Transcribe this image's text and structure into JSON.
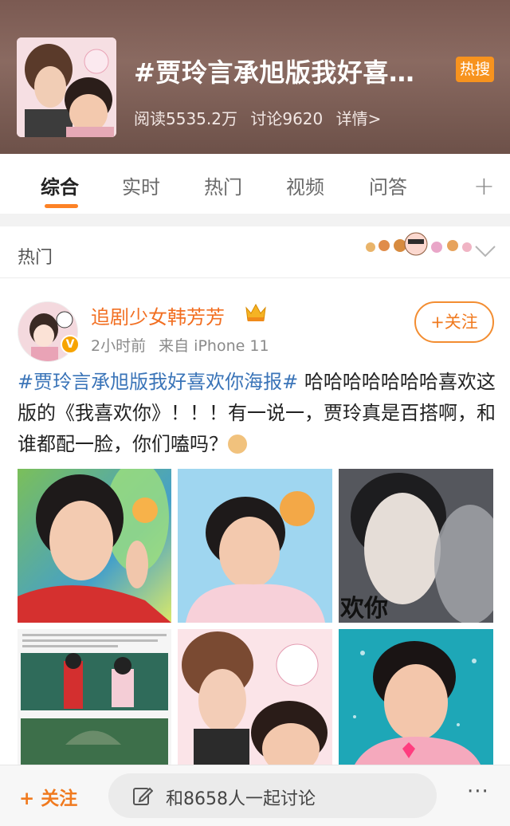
{
  "topic": {
    "title": "#贾玲言承旭版我好喜…",
    "badge": "热搜",
    "read_count": "阅读5535.2万",
    "discuss_count": "讨论9620",
    "details": "详情>"
  },
  "tabs": [
    {
      "label": "综合",
      "active": true
    },
    {
      "label": "实时",
      "active": false
    },
    {
      "label": "热门",
      "active": false
    },
    {
      "label": "视频",
      "active": false
    },
    {
      "label": "问答",
      "active": false
    }
  ],
  "tabs_more": "+",
  "section": {
    "label": "热门"
  },
  "post": {
    "username": "追剧少女韩芳芳",
    "time": "2小时前",
    "source": "来自 iPhone 11",
    "follow_label": "+关注",
    "hashtag": "#贾玲言承旭版我好喜欢你海报#",
    "text": " 哈哈哈哈哈哈哈喜欢这版的《我喜欢你》！！！有一说一，贾玲真是百搭啊，和谁都配一脸，你们嗑吗？",
    "images": [
      {
        "name": "image-1",
        "caption": ""
      },
      {
        "name": "image-2",
        "caption": ""
      },
      {
        "name": "image-3",
        "caption": "欢你"
      },
      {
        "name": "image-4",
        "caption": ""
      },
      {
        "name": "image-5",
        "caption": ""
      },
      {
        "name": "image-6",
        "caption": ""
      }
    ]
  },
  "bottom_bar": {
    "follow_label": "+ 关注",
    "discuss_label": "和8658人一起讨论",
    "more_label": "···"
  },
  "colors": {
    "accent": "#f07a1f",
    "hashtag": "#3a74b8",
    "hot_badge": "#f7931e"
  },
  "icons": {
    "verified": "verified-v-icon",
    "edit": "pencil-edit-icon",
    "chevron": "chevron-down-icon",
    "crown": "crown-badge-icon"
  }
}
